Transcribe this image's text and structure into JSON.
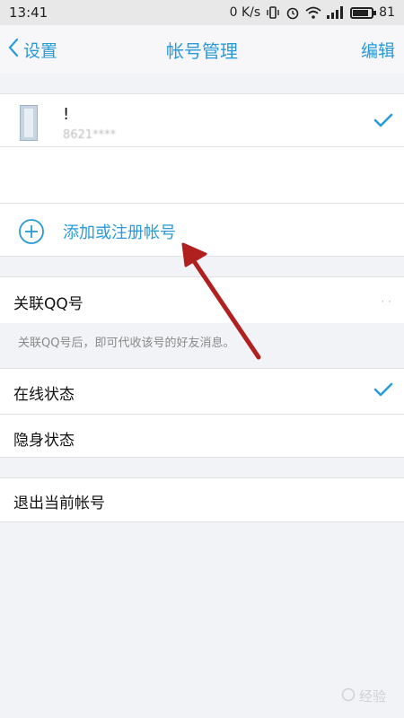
{
  "status_bar": {
    "time": "13:41",
    "net_speed": "0 K/s",
    "battery_level": "81",
    "icons": [
      "vibrate-icon",
      "alarm-icon",
      "wifi-icon",
      "signal-icon",
      "battery-icon"
    ]
  },
  "nav": {
    "back_label": "设置",
    "title": "帐号管理",
    "edit_label": "编辑"
  },
  "account": {
    "name": "!",
    "number": "8621****",
    "selected": true
  },
  "add_account": {
    "label": "添加或注册帐号",
    "icon": "plus-circle-icon"
  },
  "link_qq": {
    "label": "关联QQ号",
    "value": "· ·",
    "description": "关联QQ号后，即可代收该号的好友消息。"
  },
  "status_options": [
    {
      "label": "在线状态",
      "selected": true
    },
    {
      "label": "隐身状态",
      "selected": false
    }
  ],
  "logout": {
    "label": "退出当前帐号"
  },
  "annotation": {
    "type": "arrow",
    "color": "#b0201f"
  },
  "watermark": {
    "text": "经验"
  },
  "colors": {
    "accent": "#2a9bd8",
    "background": "#f2f3f6"
  }
}
